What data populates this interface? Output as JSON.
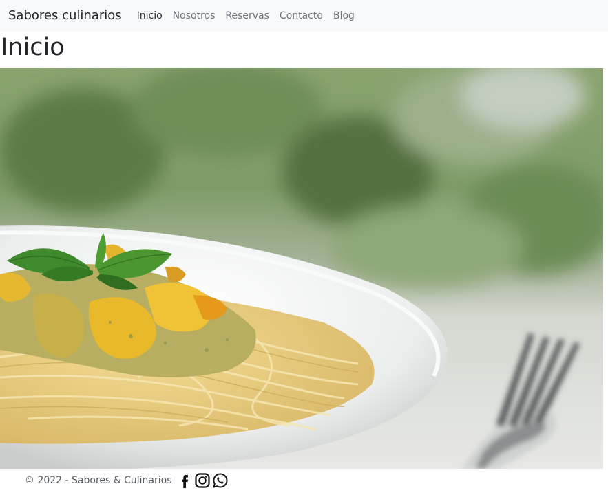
{
  "navbar": {
    "brand": "Sabores culinarios",
    "links": [
      {
        "label": "Inicio",
        "active": true
      },
      {
        "label": "Nosotros",
        "active": false
      },
      {
        "label": "Reservas",
        "active": false
      },
      {
        "label": "Contacto",
        "active": false
      },
      {
        "label": "Blog",
        "active": false
      }
    ]
  },
  "main": {
    "title": "Inicio"
  },
  "footer": {
    "copyright": "© 2022 - Sabores & Culinarios",
    "social": [
      "facebook-icon",
      "instagram-icon",
      "whatsapp-icon"
    ]
  }
}
